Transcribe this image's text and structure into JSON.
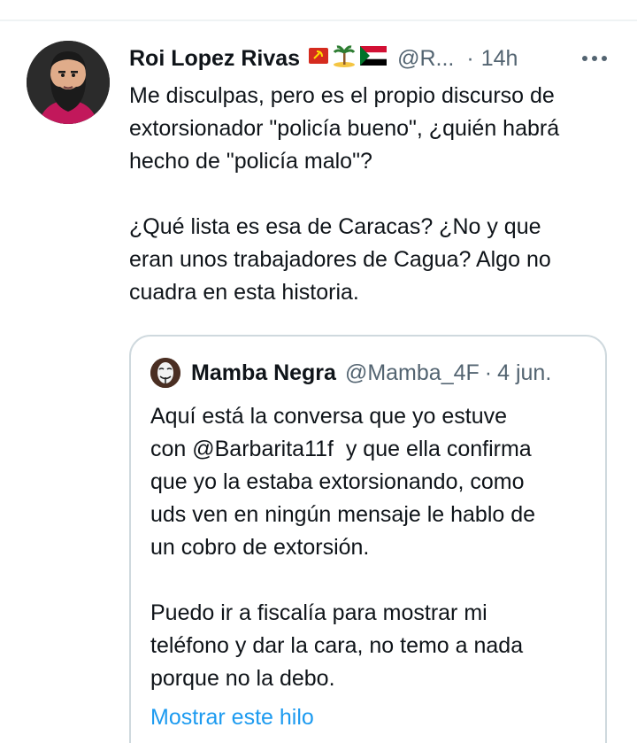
{
  "tweet": {
    "display_name": "Roi Lopez Rivas",
    "flags": [
      "🇻🇳",
      "🏝️",
      "🇸🇩"
    ],
    "handle": "@R...",
    "separator": "·",
    "time": "14h",
    "more_icon": "more-horizontal-icon",
    "text": "Me disculpas, pero es el propio discurso de\nextorsionador \"policía bueno\", ¿quién habrá\nhecho de \"policía malo\"?\n\n¿Qué lista es esa de Caracas? ¿No y que\neran unos trabajadores de Cagua? Algo no\ncuadra en esta historia."
  },
  "quote": {
    "display_name": "Mamba Negra",
    "handle": "@Mamba_4F",
    "separator": "·",
    "date": "4 jun.",
    "text": "Aquí está la conversa que yo estuve\ncon @Barbarita11f  y que ella confirma\nque yo la estaba extorsionando, como\nuds ven en ningún mensaje le hablo de\nun cobro de extorsión.\n\nPuedo ir a fiscalía para mostrar mi\nteléfono y dar la cara, no temo a nada\nporque no la debo.",
    "show_thread_label": "Mostrar este hilo"
  },
  "colors": {
    "text_primary": "#0f1419",
    "text_secondary": "#536471",
    "link": "#1d9bf0",
    "border": "#cfd9de"
  }
}
